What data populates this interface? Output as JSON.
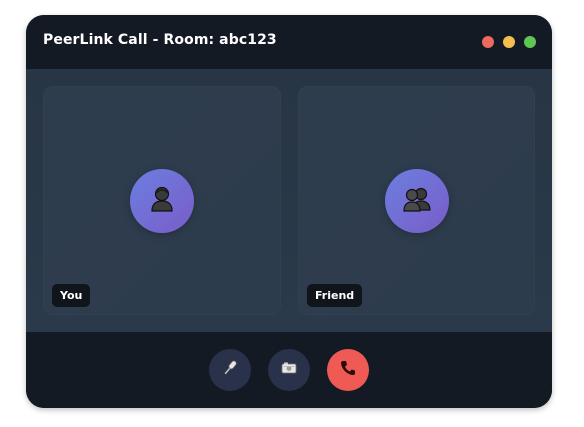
{
  "window": {
    "title": "PeerLink Call - Room: abc123",
    "traffic_lights": [
      {
        "name": "close",
        "color": "#ed6a5e"
      },
      {
        "name": "minimize",
        "color": "#f5bf4f"
      },
      {
        "name": "maximize",
        "color": "#61c554"
      }
    ]
  },
  "participants": [
    {
      "label": "You",
      "icon": "person-icon"
    },
    {
      "label": "Friend",
      "icon": "people-icon"
    }
  ],
  "controls": [
    {
      "name": "mute-button",
      "icon": "microphone-icon",
      "color": "#29324a"
    },
    {
      "name": "camera-button",
      "icon": "camera-icon",
      "color": "#29324a"
    },
    {
      "name": "end-call-button",
      "icon": "phone-icon",
      "color": "#ef5a55"
    }
  ],
  "colors": {
    "titlebar": "#141a23",
    "stage": "#273544",
    "tile": "#2e3d4e",
    "avatar_gradient": [
      "#6b7fe0",
      "#7a5cc8"
    ],
    "label_bg": "#10151c"
  }
}
